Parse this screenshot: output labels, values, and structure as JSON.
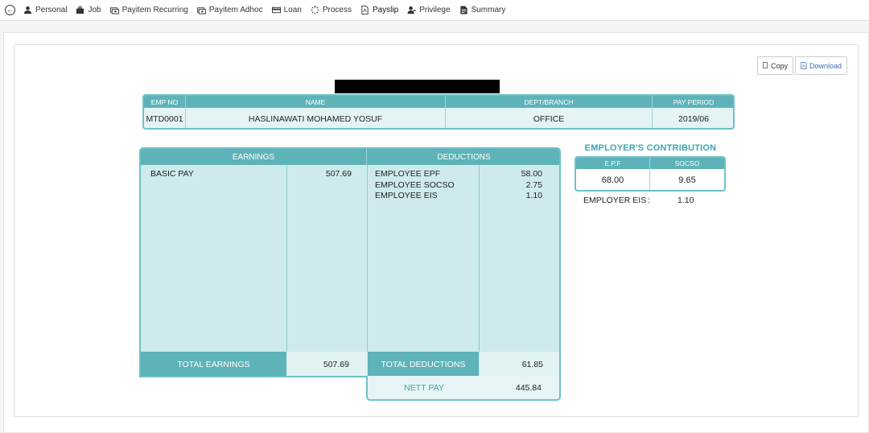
{
  "nav": {
    "items": [
      {
        "label": "Personal",
        "icon": "person-icon"
      },
      {
        "label": "Job",
        "icon": "briefcase-icon"
      },
      {
        "label": "Payitem Recurring",
        "icon": "money-icon"
      },
      {
        "label": "Payitem Adhoc",
        "icon": "money-icon"
      },
      {
        "label": "Loan",
        "icon": "card-icon"
      },
      {
        "label": "Process",
        "icon": "spinner-icon"
      },
      {
        "label": "Payslip",
        "icon": "pdf-icon"
      },
      {
        "label": "Privilege",
        "icon": "user-key-icon"
      },
      {
        "label": "Summary",
        "icon": "document-icon"
      }
    ],
    "active": "Payslip"
  },
  "actions": {
    "copy_label": "Copy",
    "download_label": "Download"
  },
  "employee": {
    "headers": {
      "emp_no": "EMP NO",
      "name": "NAME",
      "dept": "DEPT/BRANCH",
      "period": "PAY PERIOD"
    },
    "emp_no": "MTD0001",
    "name": "HASLINAWATI MOHAMED YOSUF",
    "dept": "OFFICE",
    "period": "2019/06"
  },
  "earnings": {
    "title": "EARNINGS",
    "items": [
      {
        "label": "BASIC PAY",
        "amount": "507.69"
      }
    ],
    "total_label": "TOTAL EARNINGS",
    "total": "507.69"
  },
  "deductions": {
    "title": "DEDUCTIONS",
    "items": [
      {
        "label": "EMPLOYEE EPF",
        "amount": "58.00"
      },
      {
        "label": "EMPLOYEE SOCSO",
        "amount": "2.75"
      },
      {
        "label": "EMPLOYEE EIS",
        "amount": "1.10"
      }
    ],
    "total_label": "TOTAL DEDUCTIONS",
    "total": "61.85"
  },
  "nett": {
    "label": "NETT PAY",
    "amount": "445.84"
  },
  "employer": {
    "title": "EMPLOYER'S CONTRIBUTION",
    "epf_label": "E.P.F",
    "socso_label": "SOCSO",
    "epf": "68.00",
    "socso": "9.65",
    "eis_label": "EMPLOYER EIS",
    "eis_sep": ":",
    "eis": "1.10"
  },
  "colors": {
    "accent": "#5eb3b9",
    "panel": "#cfeaec",
    "link": "#3a6fb0"
  }
}
